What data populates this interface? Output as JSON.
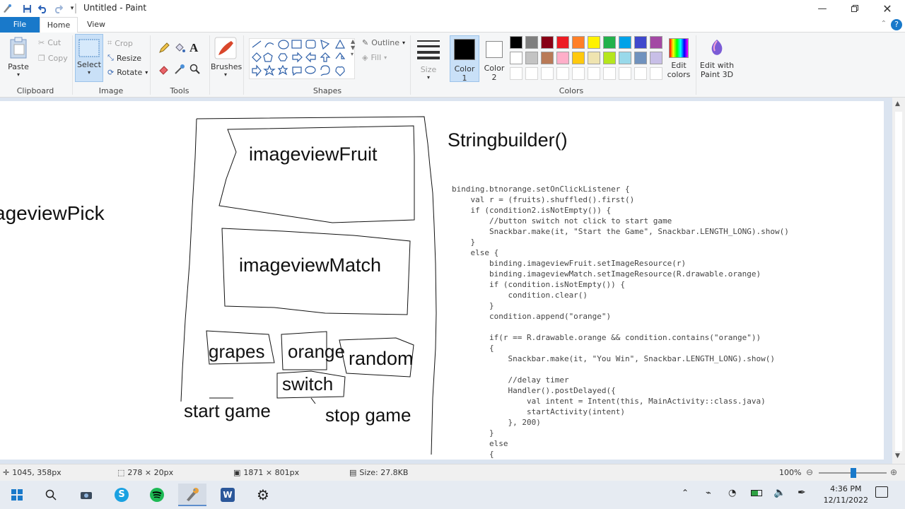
{
  "window": {
    "title": "Untitled - Paint",
    "minimize_icon": "minimize-icon",
    "maximize_icon": "maximize-icon",
    "close_icon": "close-icon"
  },
  "tabs": {
    "file": "File",
    "home": "Home",
    "view": "View"
  },
  "ribbon": {
    "clipboard": {
      "label": "Clipboard",
      "paste": "Paste",
      "cut": "Cut",
      "copy": "Copy"
    },
    "image": {
      "label": "Image",
      "select": "Select",
      "crop": "Crop",
      "resize": "Resize",
      "rotate": "Rotate"
    },
    "tools": {
      "label": "Tools"
    },
    "brushes": {
      "label": "Brushes"
    },
    "shapes": {
      "label": "Shapes",
      "outline": "Outline",
      "fill": "Fill"
    },
    "size": {
      "label": "Size"
    },
    "color1": {
      "label": "Color",
      "sub": "1",
      "value": "#000000"
    },
    "color2": {
      "label": "Color",
      "sub": "2",
      "value": "#ffffff"
    },
    "colors": {
      "label": "Colors",
      "row1": [
        "#000000",
        "#7f7f7f",
        "#880015",
        "#ed1c24",
        "#ff7f27",
        "#fff200",
        "#22b14c",
        "#00a2e8",
        "#3f48cc",
        "#a349a4"
      ],
      "row2": [
        "#ffffff",
        "#c3c3c3",
        "#b97a57",
        "#ffaec9",
        "#ffc90e",
        "#efe4b0",
        "#b5e61d",
        "#99d9ea",
        "#7092be",
        "#c8bfe7"
      ]
    },
    "edit_colors": "Edit colors",
    "edit_paint3d": "Edit with Paint 3D"
  },
  "drawing": {
    "image_pick": "ageviewPick",
    "image_fruit": "imageviewFruit",
    "image_match": "imageviewMatch",
    "grapes": "grapes",
    "orange": "orange",
    "random": "random",
    "switch": "switch",
    "start_game": "start game",
    "stop_game": "stop game",
    "stringbuilder": "Stringbuilder()"
  },
  "code_lines": [
    "binding.btnorange.setOnClickListener {",
    "    val r = (fruits).shuffled().first()",
    "    if (condition2.isNotEmpty()) {",
    "        //button switch not click to start game",
    "        Snackbar.make(it, \"Start the Game\", Snackbar.LENGTH_LONG).show()",
    "    }",
    "    else {",
    "        binding.imageviewFruit.setImageResource(r)",
    "        binding.imageviewMatch.setImageResource(R.drawable.orange)",
    "        if (condition.isNotEmpty()) {",
    "            condition.clear()",
    "        }",
    "        condition.append(\"orange\")",
    "",
    "        if(r == R.drawable.orange && condition.contains(\"orange\"))",
    "        {",
    "            Snackbar.make(it, \"You Win\", Snackbar.LENGTH_LONG).show()",
    "",
    "            //delay timer",
    "            Handler().postDelayed({",
    "                val intent = Intent(this, MainActivity::class.java)",
    "                startActivity(intent)",
    "            }, 200)",
    "        }",
    "        else",
    "        {"
  ],
  "status": {
    "cursor_pos": "1045, 358px",
    "selection_size": "278 × 20px",
    "image_size": "1871 × 801px",
    "file_size": "Size: 27.8KB",
    "zoom": "100%"
  },
  "taskbar": {
    "time": "4:36 PM",
    "date": "12/11/2022"
  }
}
